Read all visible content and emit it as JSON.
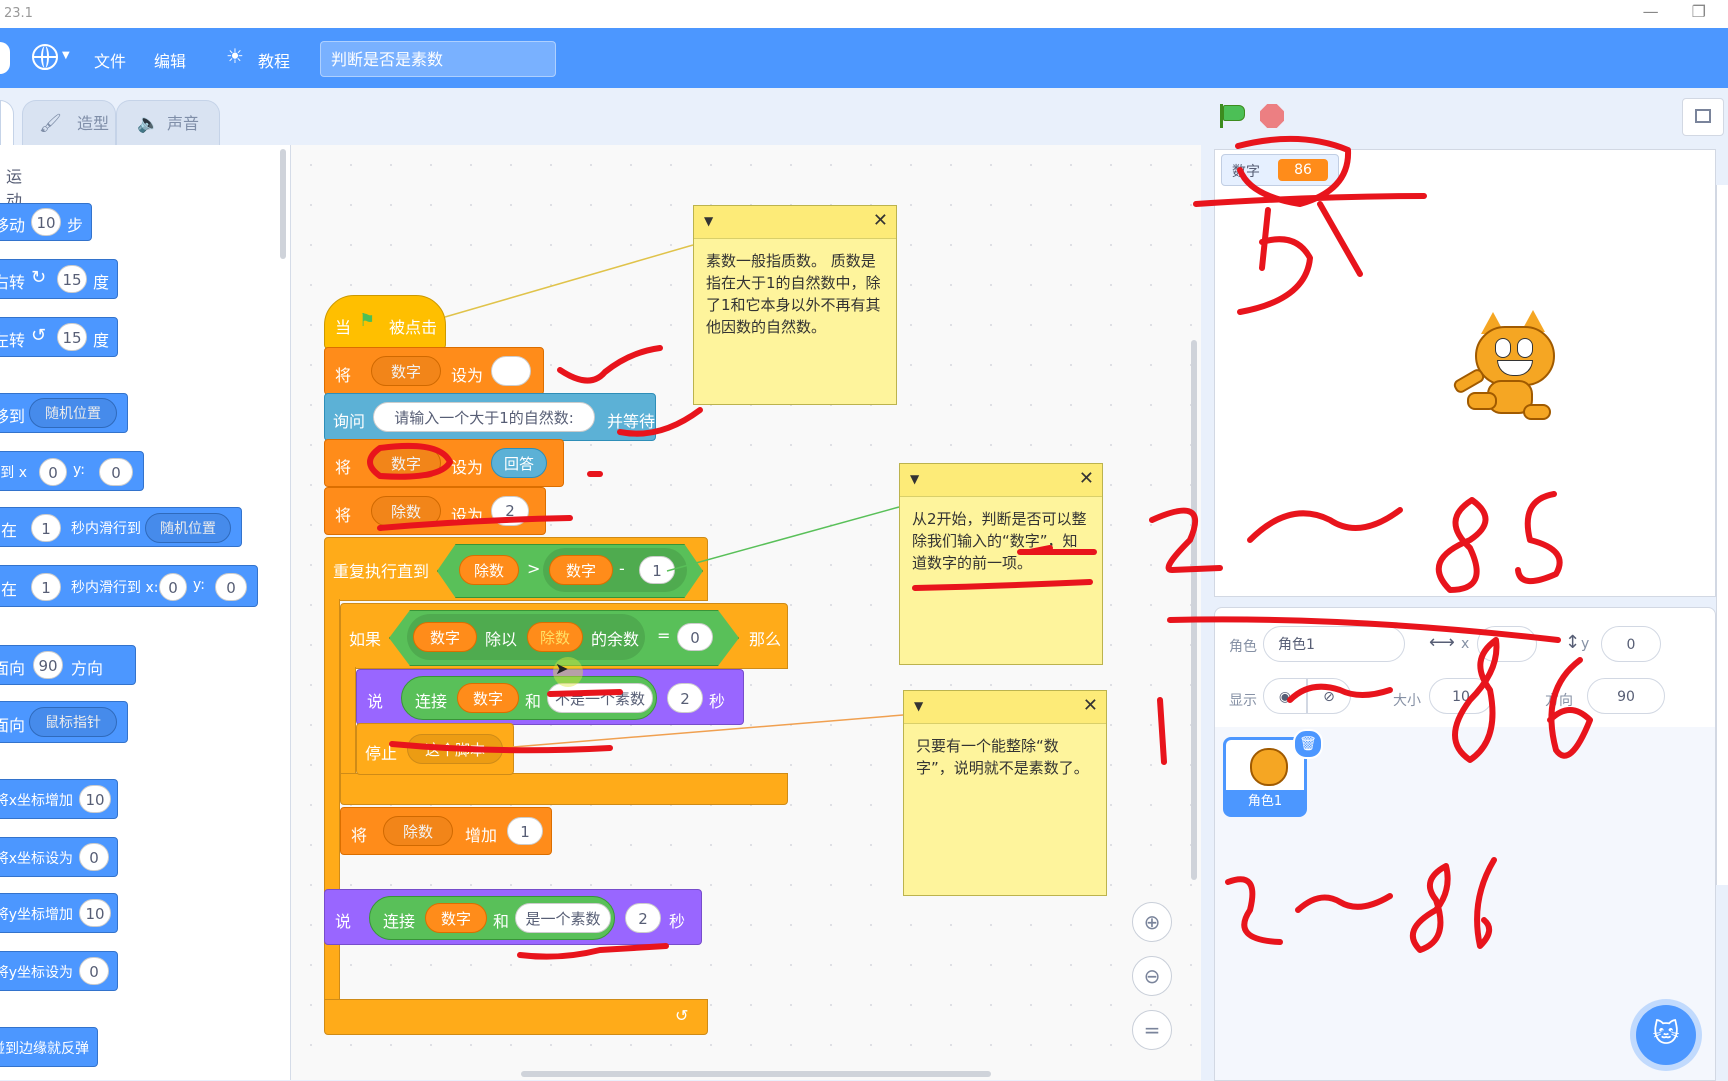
{
  "app": {
    "version_fragment": "23.1",
    "window_controls": "—  ❐"
  },
  "menu": {
    "file": "文件",
    "edit": "编辑",
    "tutorials": "教程",
    "project_title": "判断是否是素数"
  },
  "tabs": {
    "costumes": "造型",
    "sounds": "声音"
  },
  "palette": {
    "category": "运动",
    "blocks": [
      {
        "pre": "移动",
        "val": "10",
        "post": "步"
      },
      {
        "pre": "右转",
        "val": "15",
        "post": "度"
      },
      {
        "pre": "左转",
        "val": "15",
        "post": "度"
      },
      {
        "pre": "移到",
        "menu": "随机位置"
      },
      {
        "pre": "移到 x:",
        "val": "0",
        "mid": "y:",
        "val2": "0"
      },
      {
        "pre": "在",
        "val": "1",
        "mid": "秒内滑行到",
        "menu": "随机位置"
      },
      {
        "pre": "在",
        "val": "1",
        "mid": "秒内滑行到 x:",
        "val2": "0",
        "mid2": "y:",
        "val3": "0"
      },
      {
        "pre": "面向",
        "val": "90",
        "post": "方向"
      },
      {
        "pre": "面向",
        "menu": "鼠标指针"
      },
      {
        "pre": "将x坐标增加",
        "val": "10"
      },
      {
        "pre": "将x坐标设为",
        "val": "0"
      },
      {
        "pre": "将y坐标增加",
        "val": "10"
      },
      {
        "pre": "将y坐标设为",
        "val": "0"
      },
      {
        "pre": "碰到边缘就反弹"
      }
    ]
  },
  "script": {
    "hat": {
      "when": "当",
      "clicked": "被点击"
    },
    "set1": {
      "label": "将",
      "var": "数字",
      "set_to": "设为",
      "value": ""
    },
    "ask": {
      "label": "询问",
      "prompt": "请输入一个大于1的自然数:",
      "wait": "并等待"
    },
    "set2": {
      "label": "将",
      "var": "数字",
      "set_to": "设为",
      "answer": "回答"
    },
    "set3": {
      "label": "将",
      "var": "除数",
      "set_to": "设为",
      "value": "2"
    },
    "repeat": {
      "label": "重复执行直到",
      "divisor": "除数",
      "gt": ">",
      "number": "数字",
      "minus": "-",
      "one": "1"
    },
    "if": {
      "label": "如果",
      "number": "数字",
      "mod": "除以",
      "divisor": "除数",
      "remainder": "的余数",
      "eq": "=",
      "zero": "0",
      "then": "那么"
    },
    "say1": {
      "label": "说",
      "join": "连接",
      "number": "数字",
      "and": "和",
      "text": "不是一个素数",
      "secs": "2",
      "unit": "秒"
    },
    "stop": {
      "label": "停止",
      "option": "这个脚本"
    },
    "change": {
      "label": "将",
      "var": "除数",
      "inc": "增加",
      "value": "1"
    },
    "say2": {
      "label": "说",
      "join": "连接",
      "number": "数字",
      "and": "和",
      "text": "是一个素数",
      "secs": "2",
      "unit": "秒"
    }
  },
  "notes": [
    {
      "text": "素数一般指质数。 质数是指在大于1的自然数中，除了1和它本身以外不再有其他因数的自然数。"
    },
    {
      "text": "从2开始，判断是否可以整除我们输入的“数字”，知道数字的前一项。"
    },
    {
      "text": "只要有一个能整除“数字”，说明就不是素数了。"
    }
  ],
  "stage": {
    "monitor_label": "数字",
    "monitor_value": "86",
    "handwriting": [
      "5",
      "2～85",
      "1～86",
      "2～86"
    ]
  },
  "sprite_info": {
    "sprite_label": "角色",
    "sprite_name": "角色1",
    "x_label": "x",
    "x_value": "",
    "y_label": "y",
    "y_value": "0",
    "show_label": "显示",
    "size_label": "大小",
    "size_value": "10",
    "direction_label": "方向",
    "direction_value": "90",
    "thumb_name": "角色1"
  },
  "colors": {
    "menubar": "#4c97ff",
    "motion": "#4c97ff",
    "variables": "#ff8c1a",
    "control": "#ffab19",
    "looks": "#9966ff",
    "operators": "#59c059",
    "events": "#ffbf00",
    "sensing": "#5cb1d6",
    "annotation_red": "#e8141c"
  }
}
